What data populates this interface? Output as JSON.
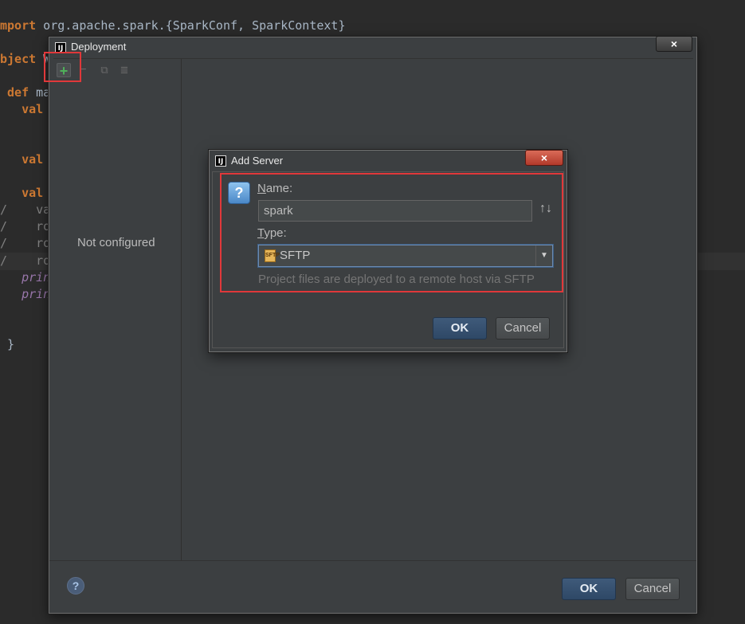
{
  "editor": {
    "lines": [
      {
        "kw": "mport",
        "rest": " org.apache.spark.{SparkConf, SparkContext}"
      },
      {
        "kw": "bject",
        "rest": " W"
      },
      {
        "kw": " def",
        "rest": " ma"
      },
      {
        "kw": "   val",
        "rest": ""
      },
      {
        "kw": "   val",
        "rest": ""
      },
      {
        "kw": "   val",
        "rest": ""
      },
      {
        "kw": "",
        "rest": "/    va"
      },
      {
        "kw": "",
        "rest": "/    ro"
      },
      {
        "kw": "",
        "rest": "/    ro"
      },
      {
        "kw": "",
        "rest": "/    ro"
      },
      {
        "kw": "",
        "rest": "   prin"
      },
      {
        "kw": "",
        "rest": "   prin"
      },
      {
        "kw": "",
        "rest": " }"
      }
    ]
  },
  "deployment": {
    "title": "Deployment",
    "icon_text": "IJ",
    "toolbar": {
      "add": "+",
      "remove": "−",
      "copy": "⧉",
      "db": "≣"
    },
    "empty_text": "Not configured",
    "ok_label": "OK",
    "cancel_label": "Cancel",
    "help": "?",
    "close": "×"
  },
  "add_server": {
    "title": "Add Server",
    "icon_text": "IJ",
    "close": "×",
    "question": "?",
    "name_label_first": "N",
    "name_label_rest": "ame:",
    "name_value": "spark",
    "sort_icon": "↑↓",
    "type_label_first": "T",
    "type_label_rest": "ype:",
    "type_value": "SFTP",
    "type_icon_text": "SFTP",
    "hint": "Project files are deployed to a remote host via SFTP",
    "ok_label": "OK",
    "cancel_label": "Cancel"
  },
  "colors": {
    "highlight": "#e0383a",
    "keyword": "#cc7832",
    "accent_button": "#2e4866"
  }
}
